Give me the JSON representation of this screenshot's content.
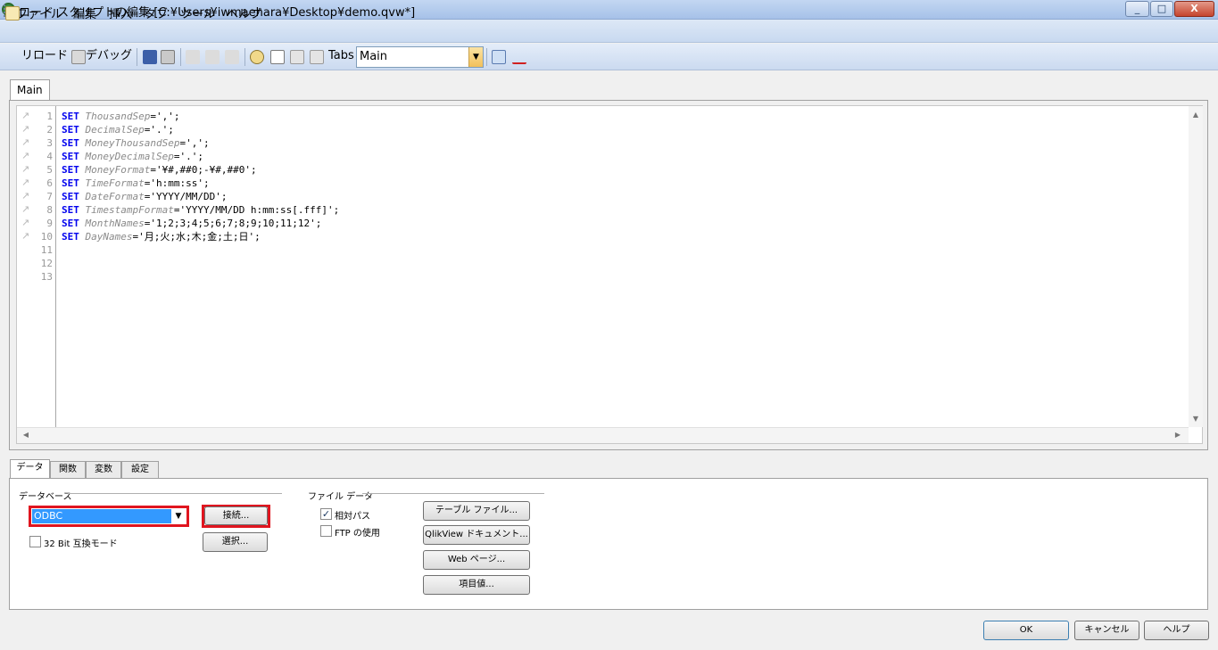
{
  "window": {
    "title": "ロード スクリプトの編集 [C:¥Users¥iwmaehara¥Desktop¥demo.qvw*]",
    "controls": {
      "minimize": "_",
      "maximize": "□",
      "close": "X"
    }
  },
  "menu": [
    "ファイル",
    "編集",
    "挿入",
    "タブ",
    "ツール",
    "ヘルプ"
  ],
  "toolbar": {
    "reload_label": "リロード",
    "debug_label": "デバッグ",
    "tabs_label": "Tabs",
    "tabs_selected": "Main",
    "icons": [
      "reload-icon",
      "debug-icon",
      "save-icon",
      "print-icon",
      "cut-icon",
      "copy-icon",
      "paste-icon",
      "find-icon",
      "new-tab-icon",
      "promote-tab-icon",
      "demote-tab-icon",
      "expand-icon",
      "spellcheck-icon"
    ]
  },
  "script_tab": "Main",
  "editor": {
    "lines": [
      {
        "num": "1",
        "kw": "SET",
        "var": "ThousandSep",
        "rest": "=',';"
      },
      {
        "num": "2",
        "kw": "SET",
        "var": "DecimalSep",
        "rest": "='.';"
      },
      {
        "num": "3",
        "kw": "SET",
        "var": "MoneyThousandSep",
        "rest": "=',';"
      },
      {
        "num": "4",
        "kw": "SET",
        "var": "MoneyDecimalSep",
        "rest": "='.';"
      },
      {
        "num": "5",
        "kw": "SET",
        "var": "MoneyFormat",
        "rest": "='¥#,##0;-¥#,##0';"
      },
      {
        "num": "6",
        "kw": "SET",
        "var": "TimeFormat",
        "rest": "='h:mm:ss';"
      },
      {
        "num": "7",
        "kw": "SET",
        "var": "DateFormat",
        "rest": "='YYYY/MM/DD';"
      },
      {
        "num": "8",
        "kw": "SET",
        "var": "TimestampFormat",
        "rest": "='YYYY/MM/DD h:mm:ss[.fff]';"
      },
      {
        "num": "9",
        "kw": "SET",
        "var": "MonthNames",
        "rest": "='1;2;3;4;5;6;7;8;9;10;11;12';"
      },
      {
        "num": "10",
        "kw": "SET",
        "var": "DayNames",
        "rest": "='月;火;水;木;金;土;日';"
      },
      {
        "num": "11",
        "kw": "",
        "var": "",
        "rest": ""
      },
      {
        "num": "12",
        "kw": "",
        "var": "",
        "rest": ""
      },
      {
        "num": "13",
        "kw": "",
        "var": "",
        "rest": ""
      }
    ]
  },
  "bottom_tabs": [
    "データ",
    "関数",
    "変数",
    "設定"
  ],
  "data_panel": {
    "database_group": "データベース",
    "db_selected": "ODBC",
    "connect_button": "接続...",
    "select_button": "選択...",
    "bit32_label": "32 Bit 互換モード",
    "bit32_checked": false,
    "file_group": "ファイル データ",
    "relative_path_label": "相対パス",
    "relative_path_checked": true,
    "ftp_label": "FTP の使用",
    "ftp_checked": false,
    "table_file_button": "テーブル ファイル...",
    "qlikview_doc_button": "QlikView ドキュメント...",
    "web_page_button": "Web ページ...",
    "field_value_button": "項目値..."
  },
  "dialog_buttons": {
    "ok": "OK",
    "cancel": "キャンセル",
    "help": "ヘルプ"
  },
  "colors": {
    "highlight_outline": "#e0151f",
    "keyword": "#0000ee",
    "selection": "#3399ff"
  }
}
